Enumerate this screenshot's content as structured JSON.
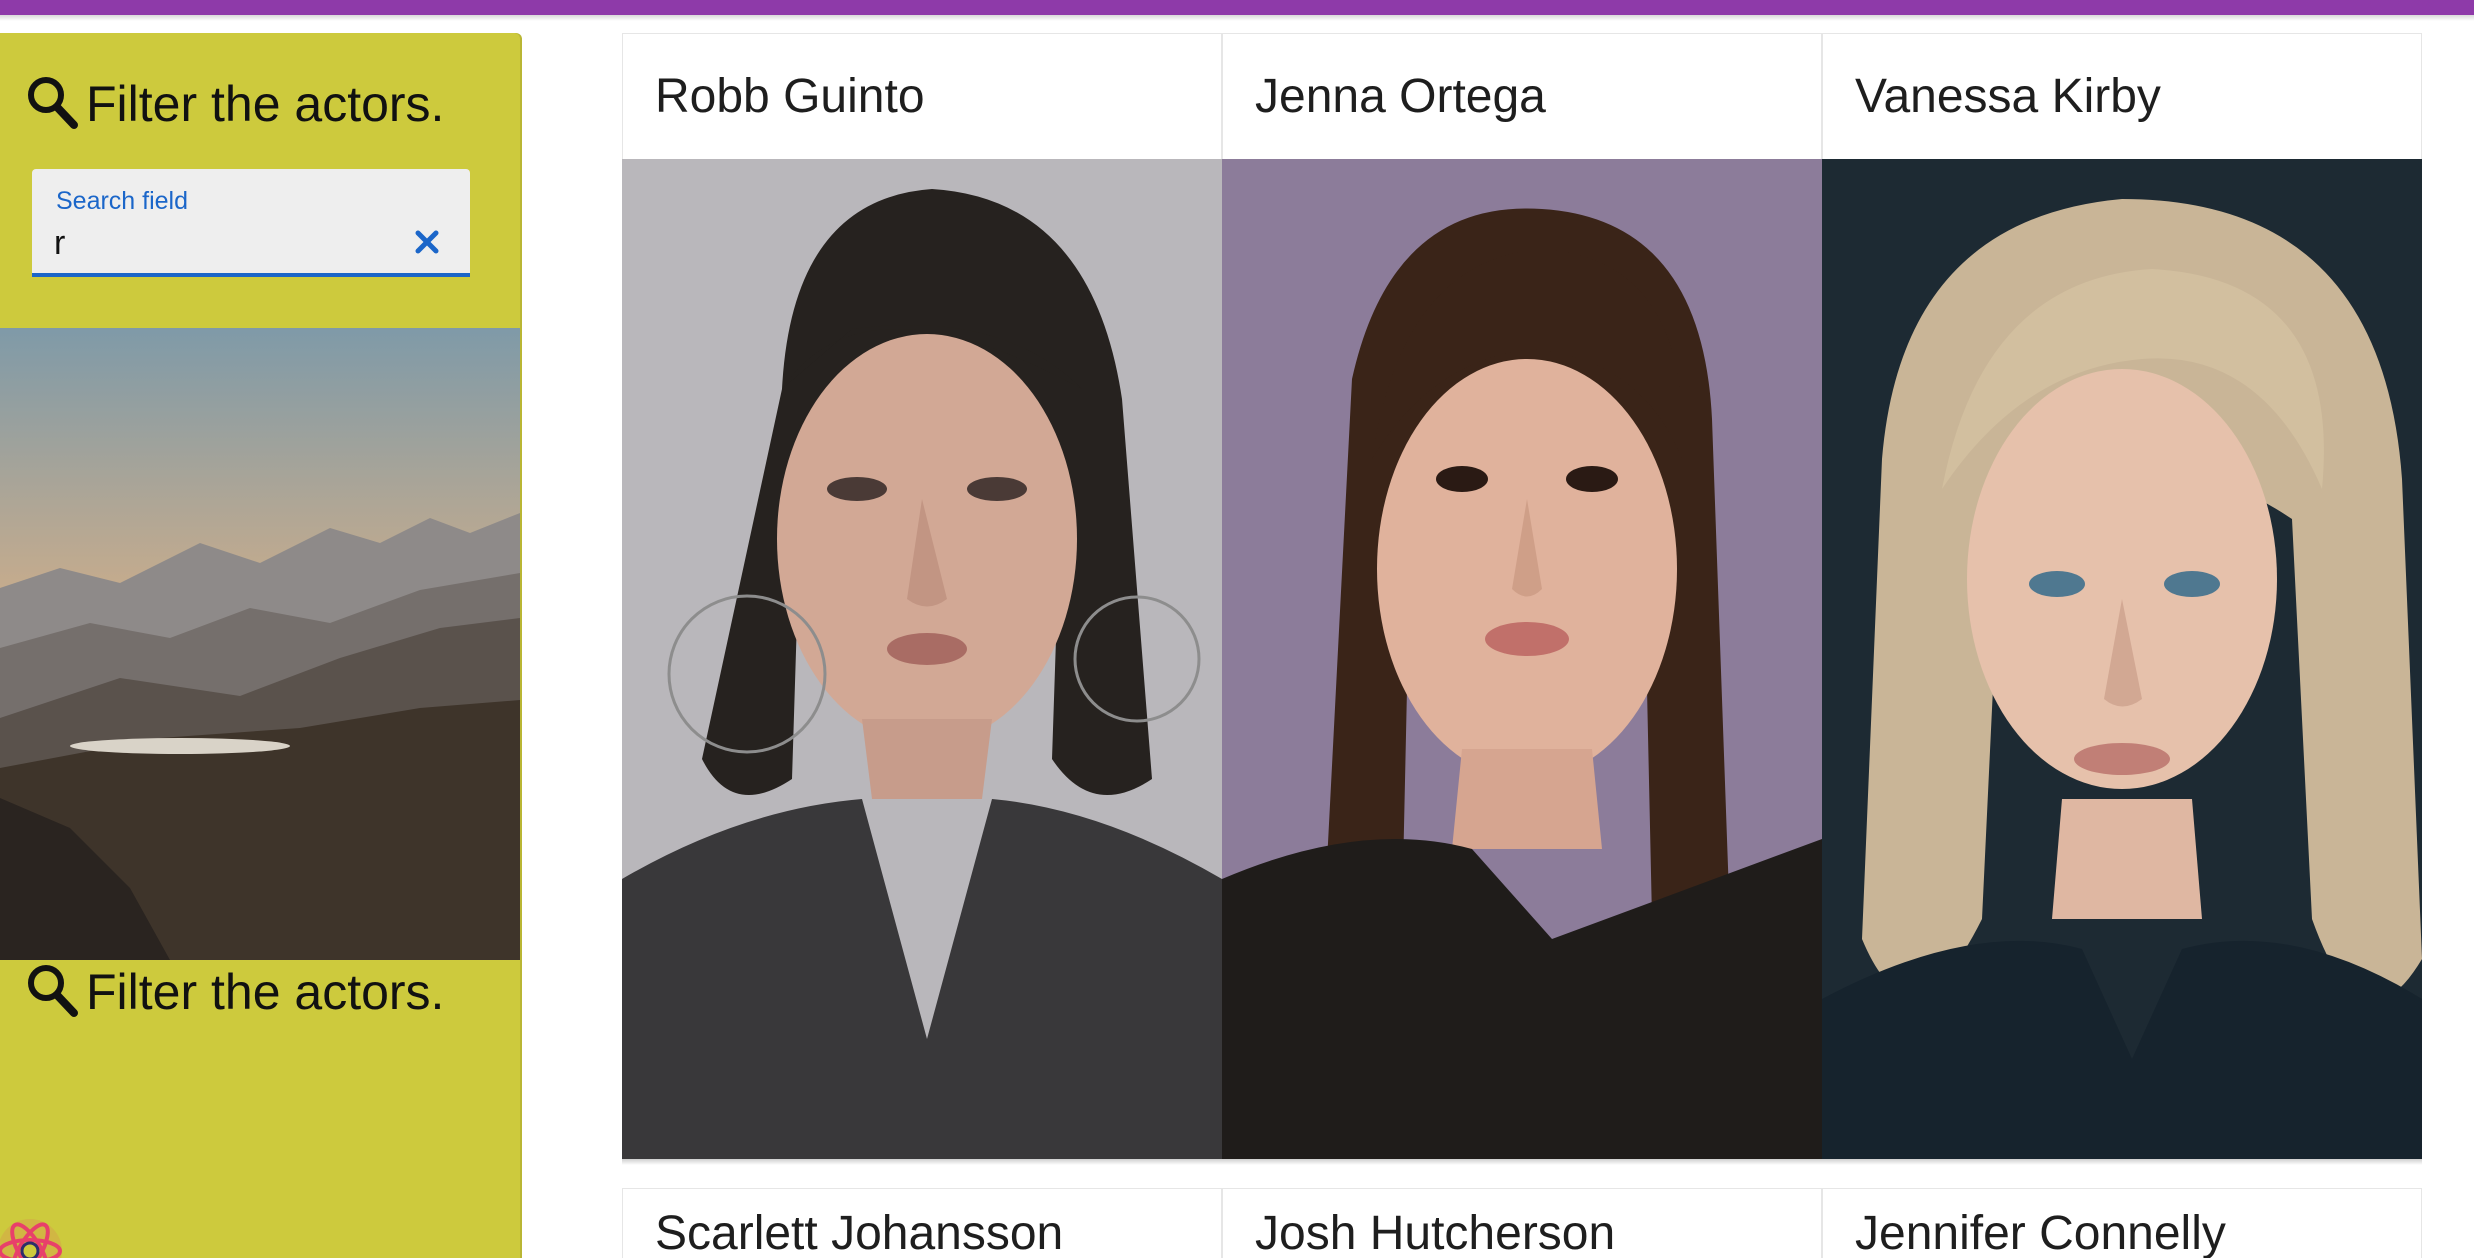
{
  "sidebar": {
    "filter_label": "Filter the actors.",
    "filter_label_repeat": "Filter the actors.",
    "search": {
      "label": "Search field",
      "value": "r",
      "clear_icon": "close-icon"
    },
    "image": "mountain-landscape",
    "logo_icon": "react-atom-icon"
  },
  "actors": [
    {
      "name": "Robb Guinto",
      "photo": "portrait-robb-guinto"
    },
    {
      "name": "Jenna Ortega",
      "photo": "portrait-jenna-ortega"
    },
    {
      "name": "Vanessa Kirby",
      "photo": "portrait-vanessa-kirby"
    },
    {
      "name": "Scarlett Johansson"
    },
    {
      "name": "Josh Hutcherson"
    },
    {
      "name": "Jennifer Connelly"
    }
  ],
  "colors": {
    "top_bar": "#8e3aa9",
    "sidebar_bg": "#cdca3d",
    "accent_blue": "#1b66c9"
  }
}
